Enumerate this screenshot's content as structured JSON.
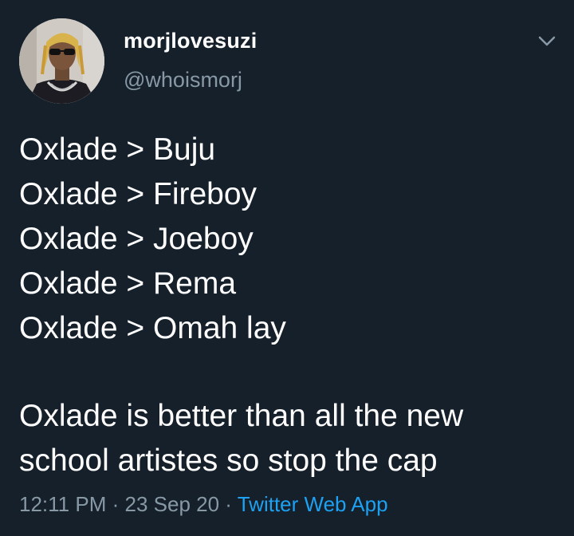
{
  "user": {
    "display_name": "morjlovesuzi",
    "handle": "@whoismorj"
  },
  "tweet": {
    "lines": [
      "Oxlade > Buju",
      "Oxlade > Fireboy",
      "Oxlade > Joeboy",
      "Oxlade > Rema",
      "Oxlade > Omah lay"
    ],
    "paragraph_lines": [
      "Oxlade is better than all the new",
      "school artistes so stop the cap"
    ]
  },
  "meta": {
    "time": "12:11 PM",
    "separator": "·",
    "date": "23 Sep 20",
    "source": "Twitter Web App"
  },
  "icons": {
    "menu": "chevron-down-icon"
  },
  "colors": {
    "background": "#15202b",
    "primary_text": "#ffffff",
    "secondary_text": "#8899a6",
    "link": "#1da1f2"
  }
}
